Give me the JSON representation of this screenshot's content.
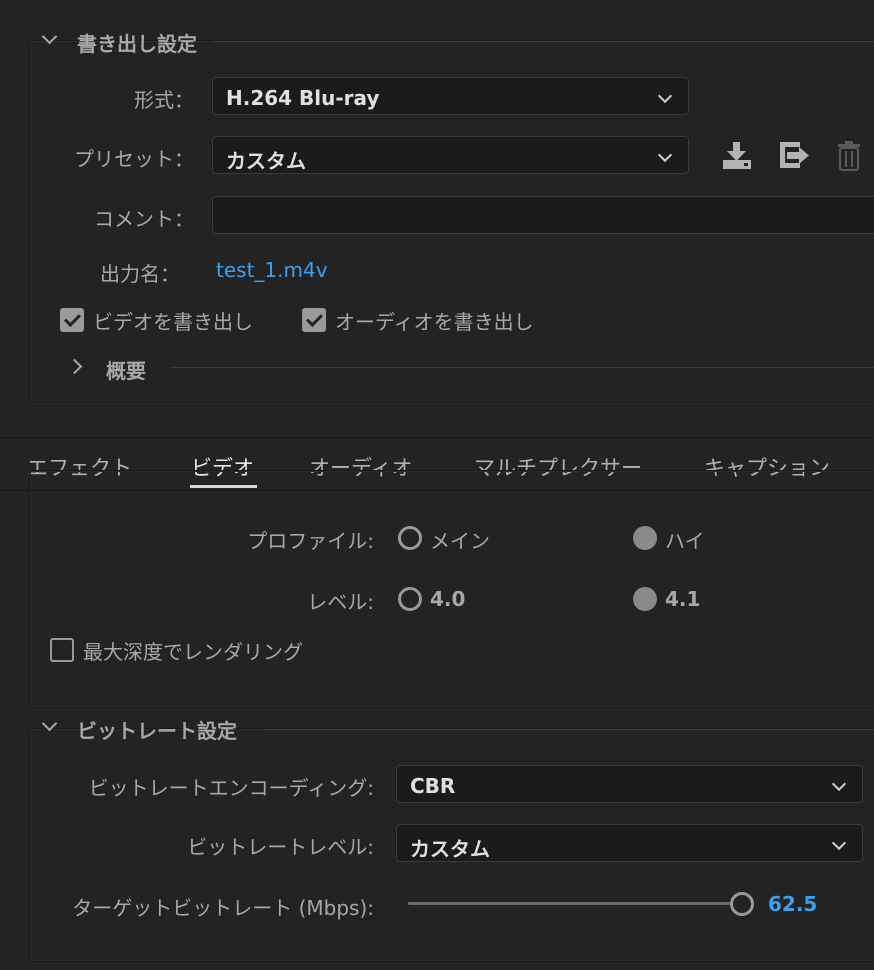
{
  "export_settings": {
    "title": "書き出し設定",
    "format_label": "形式：",
    "format_value": "H.264 Blu-ray",
    "preset_label": "プリセット：",
    "preset_value": "カスタム",
    "comment_label": "コメント：",
    "comment_value": "",
    "output_name_label": "出力名：",
    "output_name_value": "test_1.m4v",
    "export_video_label": "ビデオを書き出し",
    "export_video_checked": true,
    "export_audio_label": "オーディオを書き出し",
    "export_audio_checked": true,
    "summary_label": "概要"
  },
  "tabs": [
    {
      "label": "エフェクト",
      "active": false
    },
    {
      "label": "ビデオ",
      "active": true
    },
    {
      "label": "オーディオ",
      "active": false
    },
    {
      "label": "マルチプレクサー",
      "active": false
    },
    {
      "label": "キャプション",
      "active": false
    }
  ],
  "video": {
    "profile_label": "プロファイル:",
    "profile_main": "メイン",
    "profile_high": "ハイ",
    "level_label": "レベル:",
    "level_40": "4.0",
    "level_41": "4.1",
    "max_depth_label": "最大深度でレンダリング",
    "max_depth_checked": false
  },
  "bitrate": {
    "title": "ビットレート設定",
    "encoding_label": "ビットレートエンコーディング:",
    "encoding_value": "CBR",
    "level_label": "ビットレートレベル:",
    "level_value": "カスタム",
    "target_label": "ターゲットビットレート (Mbps):",
    "target_value": "62.5"
  },
  "icons": [
    "chevron-down-icon",
    "chevron-right-icon",
    "save-preset-icon",
    "import-preset-icon",
    "delete-preset-icon"
  ],
  "colors": {
    "background": "#232323",
    "accent_link": "#3aa0f0",
    "field_bg": "#1b1b1b"
  }
}
